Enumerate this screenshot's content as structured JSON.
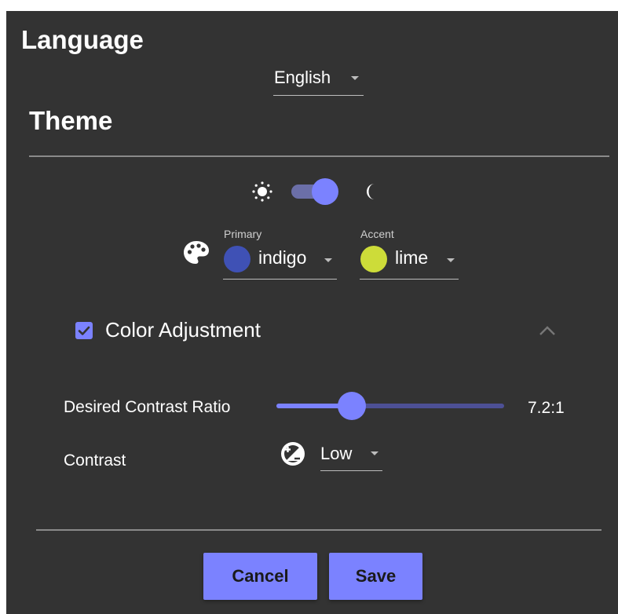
{
  "language": {
    "title": "Language",
    "selected": "English"
  },
  "theme": {
    "title": "Theme",
    "dark_mode_enabled": true,
    "primary": {
      "label": "Primary",
      "value": "indigo",
      "swatch_color": "#3f51b5"
    },
    "accent": {
      "label": "Accent",
      "value": "lime",
      "swatch_color": "#cddc39"
    },
    "icons": {
      "light": "sun-icon",
      "dark": "moon-icon",
      "palette": "palette-icon"
    }
  },
  "color_adjustment": {
    "label": "Color Adjustment",
    "checked": true,
    "expanded": true,
    "desired_contrast_ratio": {
      "label": "Desired Contrast Ratio",
      "value": 7.2,
      "display": "7.2:1",
      "slider_fraction": 0.33
    },
    "contrast": {
      "label": "Contrast",
      "selected": "Low"
    }
  },
  "actions": {
    "cancel_label": "Cancel",
    "save_label": "Save"
  },
  "colors": {
    "panel_background": "#333333",
    "accent_ui": "#7b82ff",
    "text": "#ffffff"
  }
}
